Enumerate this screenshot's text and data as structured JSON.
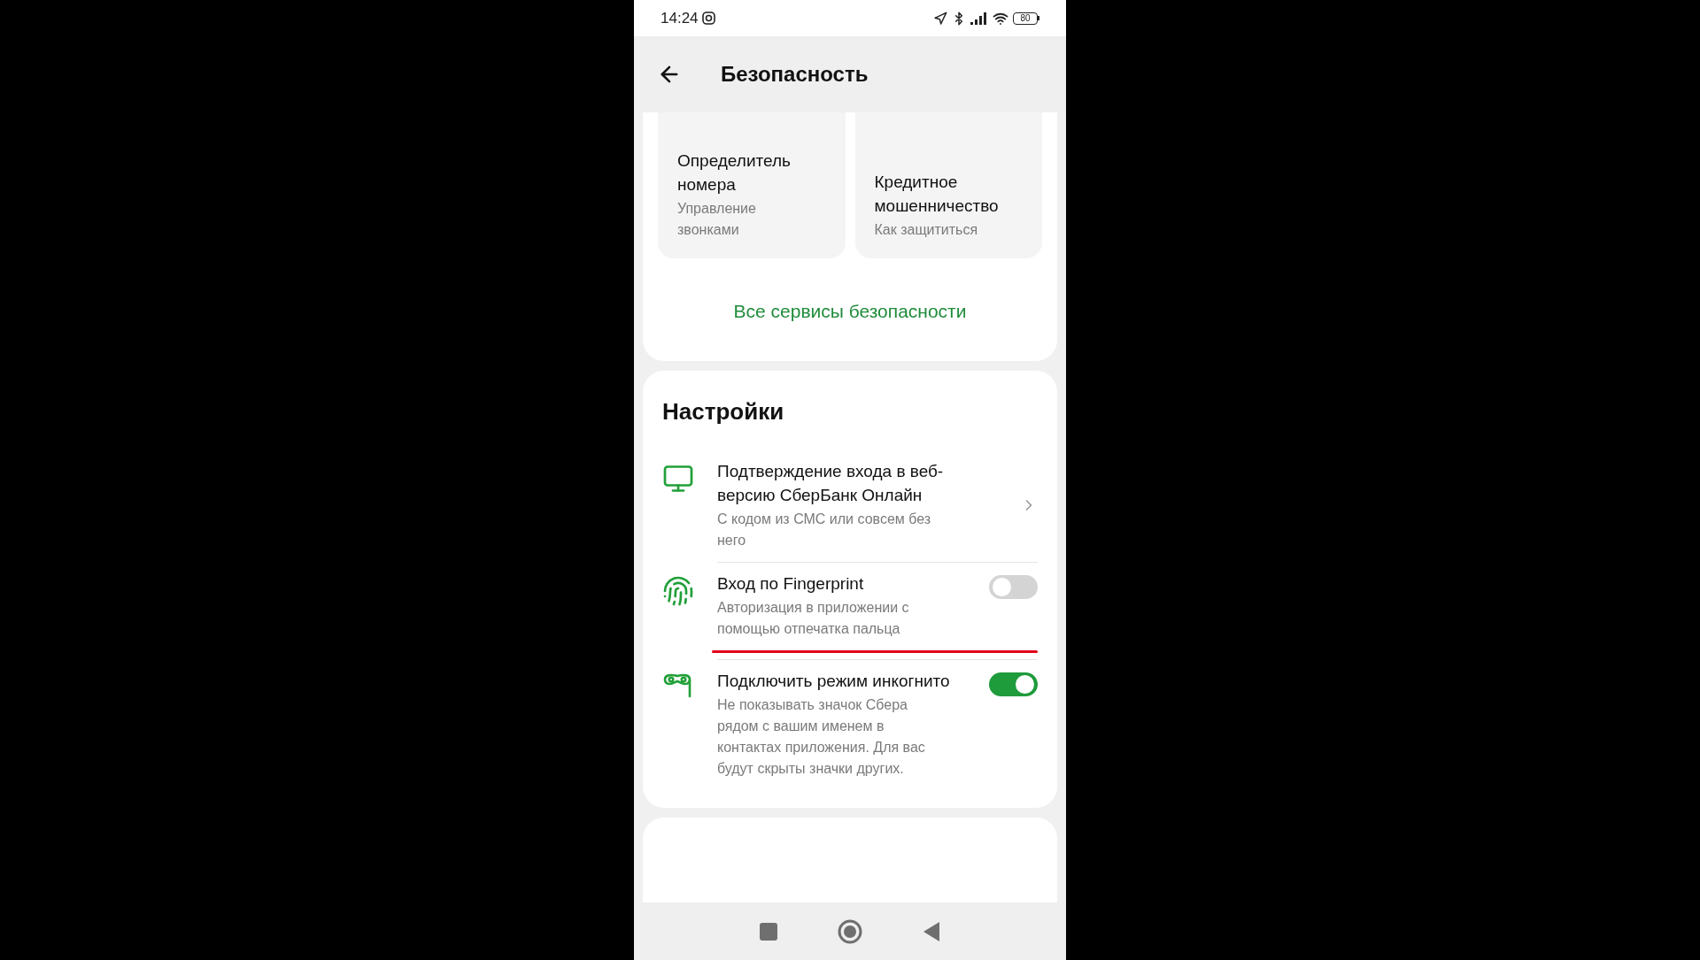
{
  "status_bar": {
    "time": "14:24",
    "battery": "80"
  },
  "header": {
    "title": "Безопасность"
  },
  "service_tiles": [
    {
      "title": "Определитель номера",
      "subtitle": "Управление звонками"
    },
    {
      "title": "Кредитное мошенничество",
      "subtitle": "Как защититься"
    }
  ],
  "all_services_link": "Все сервисы безопасности",
  "settings": {
    "title": "Настройки",
    "items": [
      {
        "kind": "link",
        "title": "Подтверждение входа в веб-версию СберБанк Онлайн",
        "description": "С кодом из СМС или совсем без него",
        "underlined": false
      },
      {
        "kind": "toggle",
        "title": "Вход по Fingerprint",
        "description": "Авторизация в приложении с помощью отпечатка пальца",
        "on": false,
        "underlined": true
      },
      {
        "kind": "toggle",
        "title": "Подключить режим инкогнито",
        "description": "Не показывать значок Сбера рядом с вашим именем в контактах приложения. Для вас будут скрыты значки других.",
        "on": true,
        "underlined": false
      }
    ]
  }
}
